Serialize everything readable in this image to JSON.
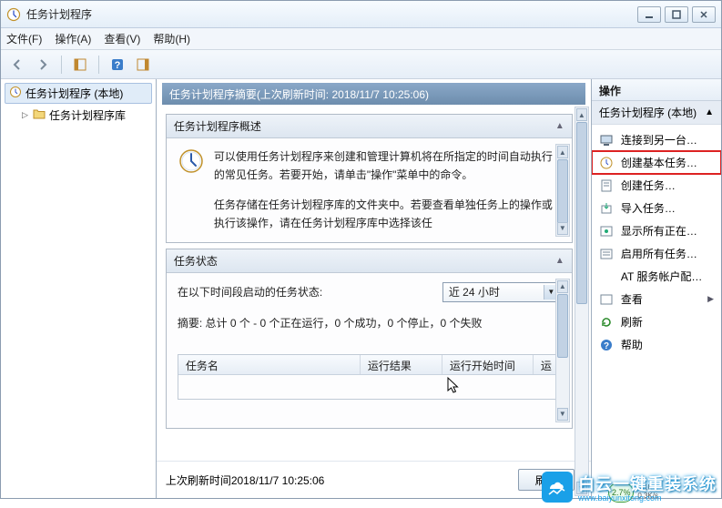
{
  "window": {
    "title": "任务计划程序"
  },
  "menu": {
    "file": "文件(F)",
    "action": "操作(A)",
    "view": "查看(V)",
    "help": "帮助(H)"
  },
  "tree": {
    "root": "任务计划程序 (本地)",
    "child": "任务计划程序库"
  },
  "center": {
    "summary_header": "任务计划程序摘要(上次刷新时间: 2018/11/7 10:25:06)",
    "overview": {
      "title": "任务计划程序概述",
      "para1": "可以使用任务计划程序来创建和管理计算机将在所指定的时间自动执行的常见任务。若要开始，请单击\"操作\"菜单中的命令。",
      "para2": "任务存储在任务计划程序库的文件夹中。若要查看单独任务上的操作或执行该操作，请在任务计划程序库中选择该任"
    },
    "status": {
      "title": "任务状态",
      "label": "在以下时间段启动的任务状态:",
      "combo": "近 24 小时",
      "summary": "摘要: 总计 0 个 - 0 个正在运行，0 个成功，0 个停止，0 个失败"
    },
    "table": {
      "col1": "任务名",
      "col2": "运行结果",
      "col3": "运行开始时间",
      "col4": "运"
    },
    "footer": {
      "last_refresh": "上次刷新时间2018/11/7 10:25:06",
      "refresh_btn": "刷新"
    }
  },
  "actions": {
    "pane_title": "操作",
    "group_title": "任务计划程序 (本地)",
    "items": {
      "connect": "连接到另一台…",
      "create_basic": "创建基本任务…",
      "create_task": "创建任务…",
      "import": "导入任务…",
      "show_running": "显示所有正在…",
      "enable_history": "启用所有任务…",
      "at_service": "AT 服务帐户配…",
      "view": "查看",
      "refresh": "刷新",
      "help": "帮助"
    }
  },
  "watermark": {
    "brand": "白云一键重装系统",
    "url": "www.baiyunxitong.com",
    "percent": "2.7%",
    "rate_up": "0.1K/s",
    "rate_down": "0.3K/s"
  }
}
